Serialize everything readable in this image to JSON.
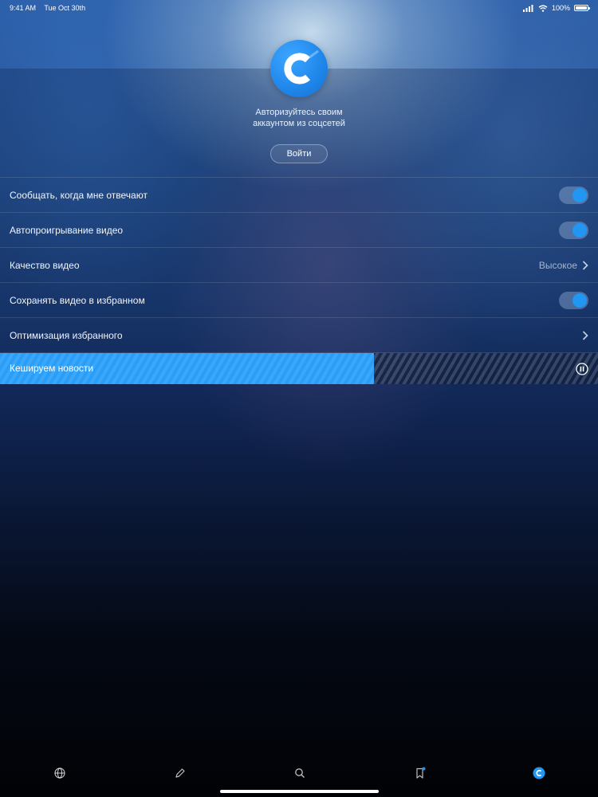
{
  "status_bar": {
    "time": "9:41 AM",
    "date": "Tue Oct 30th",
    "battery": "100%"
  },
  "header": {
    "auth_line1": "Авторизуйтесь своим",
    "auth_line2": "аккаунтом из соцсетей",
    "login_label": "Войти"
  },
  "settings": {
    "notify_replies": {
      "label": "Сообщать, когда мне отвечают",
      "on": true
    },
    "autoplay_video": {
      "label": "Автопроигрывание видео",
      "on": true
    },
    "video_quality": {
      "label": "Качество видео",
      "value": "Высокое"
    },
    "save_video_favorites": {
      "label": "Сохранять видео в избранном",
      "on": true
    },
    "optimize_favorites": {
      "label": "Оптимизация избранного"
    }
  },
  "cache": {
    "label": "Кешируем новости",
    "progress": 0.625
  },
  "tabs": [
    {
      "icon": "globe-icon"
    },
    {
      "icon": "pencil-icon"
    },
    {
      "icon": "search-icon"
    },
    {
      "icon": "bookmark-icon",
      "badge": true
    },
    {
      "icon": "profile-logo-icon",
      "active": true
    }
  ],
  "colors": {
    "accent": "#2196f3",
    "progress_fill": "#2a9ef7"
  }
}
